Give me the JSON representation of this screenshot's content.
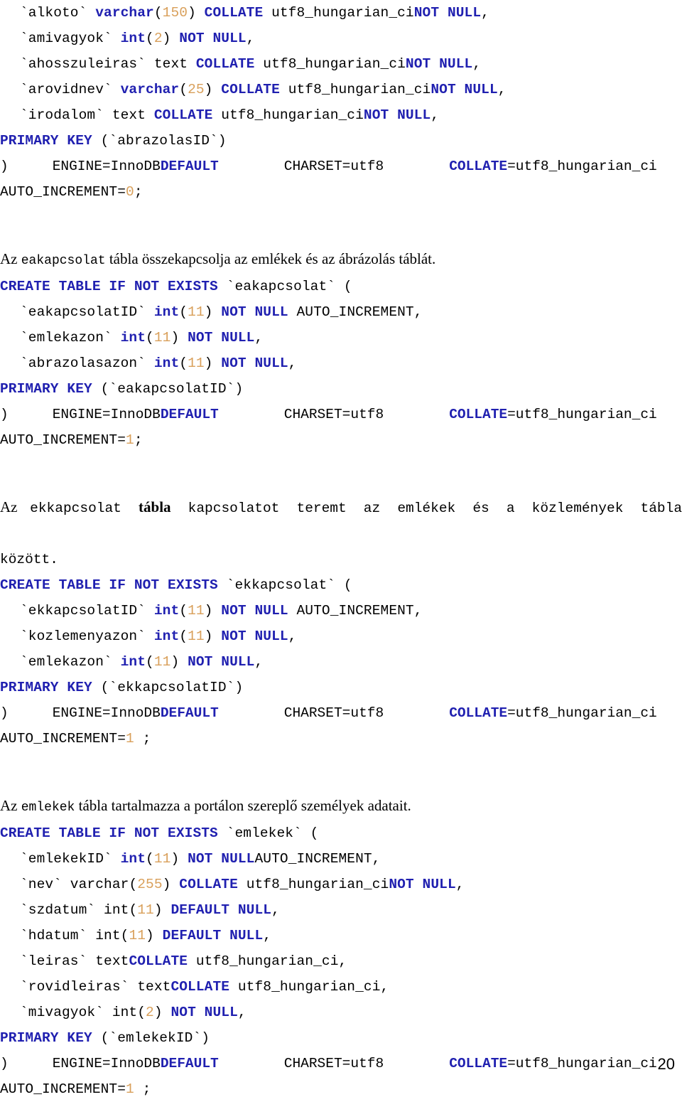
{
  "document": {
    "page_number": "20",
    "colors": {
      "keyword": "#2020B0",
      "number": "#D9A05B",
      "text": "#000000",
      "background": "#FFFFFF"
    }
  },
  "blocks": {
    "abrazolas_tail": {
      "lines": {
        "alkoto": {
          "name": "`alkoto` ",
          "type": "varchar",
          "open": "(",
          "size": "150",
          "close": ") ",
          "collate_kw": "COLLATE",
          "collate_val": " utf8_hungarian_ci",
          "nullness": "NOT NULL",
          "comma": ","
        },
        "amivagyok": {
          "name": "`amivagyok` ",
          "type": "int",
          "open": "(",
          "size": "2",
          "close": ") ",
          "nullness": "NOT NULL",
          "comma": ","
        },
        "ahosszuleiras": {
          "name": "`ahosszuleiras` ",
          "type": "text ",
          "collate_kw": "COLLATE",
          "collate_val": " utf8_hungarian_ci",
          "nullness": "NOT NULL",
          "comma": ","
        },
        "arovidnev": {
          "name": "`arovidnev` ",
          "type": "varchar",
          "open": "(",
          "size": "25",
          "close": ") ",
          "collate_kw": "COLLATE",
          "collate_val": " utf8_hungarian_ci",
          "nullness": "NOT NULL",
          "comma": ","
        },
        "irodalom": {
          "name": "`irodalom` ",
          "type": "text ",
          "collate_kw": "COLLATE",
          "collate_val": " utf8_hungarian_ci",
          "nullness": "NOT NULL",
          "comma": ","
        },
        "primary_key": {
          "kw": "PRIMARY KEY",
          "rest": " (`abrazolasID`)"
        },
        "engine": {
          "paren": ")",
          "engine": "ENGINE=InnoDB",
          "default_kw": "DEFAULT",
          "charset": "CHARSET=utf8",
          "collate_kw": "COLLATE",
          "collate_val": "=utf8_hungarian_ci"
        },
        "auto_increment": {
          "label": "AUTO_INCREMENT=",
          "value": "0",
          "semicolon": ";"
        }
      }
    },
    "eakapcsolat": {
      "prose": {
        "prefix": "Az ",
        "code": "eakapcsolat",
        "suffix": " tábla összekapcsolja az emlékek és az ábrázolás táblát."
      },
      "lines": {
        "create": {
          "kw": "CREATE TABLE IF NOT EXISTS",
          "rest": " `eakapcsolat` ("
        },
        "id": {
          "name": "`eakapcsolatID` ",
          "type": "int",
          "open": "(",
          "size": "11",
          "close": ") ",
          "nullness": "NOT NULL",
          "auto": " AUTO_INCREMENT,"
        },
        "emlekazon": {
          "name": "`emlekazon` ",
          "type": "int",
          "open": "(",
          "size": "11",
          "close": ") ",
          "nullness": "NOT NULL",
          "comma": ","
        },
        "abrazolasazon": {
          "name": "`abrazolasazon` ",
          "type": "int",
          "open": "(",
          "size": "11",
          "close": ") ",
          "nullness": "NOT NULL",
          "comma": ","
        },
        "primary_key": {
          "kw": "PRIMARY KEY",
          "rest": " (`eakapcsolatID`)"
        },
        "engine": {
          "paren": ")",
          "engine": "ENGINE=InnoDB",
          "default_kw": "DEFAULT",
          "charset": "CHARSET=utf8",
          "collate_kw": "COLLATE",
          "collate_val": "=utf8_hungarian_ci"
        },
        "auto_increment": {
          "label": "AUTO_INCREMENT=",
          "value": "1",
          "semicolon": ";"
        }
      }
    },
    "ekkapcsolat": {
      "prose": {
        "prefix": "Az ",
        "code": "ekkapcsolat",
        "bold": "tábla",
        "middle": "kapcsolatot teremt az emlékek és a közlemények tábla",
        "last": "között."
      },
      "lines": {
        "create": {
          "kw": "CREATE TABLE IF NOT EXISTS",
          "rest": " `ekkapcsolat` ("
        },
        "id": {
          "name": "`ekkapcsolatID` ",
          "type": "int",
          "open": "(",
          "size": "11",
          "close": ") ",
          "nullness": "NOT NULL",
          "auto": " AUTO_INCREMENT,"
        },
        "kozlemenyazon": {
          "name": "`kozlemenyazon` ",
          "type": "int",
          "open": "(",
          "size": "11",
          "close": ") ",
          "nullness": "NOT NULL",
          "comma": ","
        },
        "emlekazon": {
          "name": "`emlekazon` ",
          "type": "int",
          "open": "(",
          "size": "11",
          "close": ") ",
          "nullness": "NOT NULL",
          "comma": ","
        },
        "primary_key": {
          "kw": "PRIMARY KEY",
          "rest": " (`ekkapcsolatID`)"
        },
        "engine": {
          "paren": ")",
          "engine": "ENGINE=InnoDB",
          "default_kw": "DEFAULT",
          "charset": "CHARSET=utf8",
          "collate_kw": "COLLATE",
          "collate_val": "=utf8_hungarian_ci"
        },
        "auto_increment": {
          "label": "AUTO_INCREMENT=",
          "value": "1",
          "semicolon": " ;"
        }
      }
    },
    "emlekek": {
      "prose": {
        "prefix": "Az ",
        "code": "emlekek",
        "suffix": " tábla tartalmazza a portálon szereplő személyek adatait."
      },
      "lines": {
        "create": {
          "kw": "CREATE TABLE IF NOT EXISTS",
          "rest": " `emlekek` ("
        },
        "id": {
          "name": "`emlekekID` ",
          "type": "int",
          "open": "(",
          "size": "11",
          "close": ") ",
          "nullness": "NOT NULL",
          "auto": "AUTO_INCREMENT,"
        },
        "nev": {
          "name": "`nev` varchar",
          "open": "(",
          "size": "255",
          "close": ") ",
          "collate_kw": "COLLATE",
          "collate_val": " utf8_hungarian_ci",
          "nullness": "NOT NULL",
          "comma": ","
        },
        "szdatum": {
          "name": "`szdatum` int",
          "open": "(",
          "size": "11",
          "close": ") ",
          "nullness": "DEFAULT NULL",
          "comma": ","
        },
        "hdatum": {
          "name": "`hdatum` int",
          "open": "(",
          "size": "11",
          "close": ") ",
          "nullness": "DEFAULT NULL",
          "comma": ","
        },
        "leiras": {
          "name": "`leiras` text",
          "collate_kw": "COLLATE",
          "collate_val": " utf8_hungarian_ci,"
        },
        "rovidleiras": {
          "name": "`rovidleiras` text",
          "collate_kw": "COLLATE",
          "collate_val": " utf8_hungarian_ci,"
        },
        "mivagyok": {
          "name": "`mivagyok` int",
          "open": "(",
          "size": "2",
          "close": ") ",
          "nullness": "NOT NULL",
          "comma": ","
        },
        "primary_key": {
          "kw": "PRIMARY KEY",
          "rest": " (`emlekekID`)"
        },
        "engine": {
          "paren": ")",
          "engine": "ENGINE=InnoDB",
          "default_kw": "DEFAULT",
          "charset": "CHARSET=utf8",
          "collate_kw": "COLLATE",
          "collate_val": "=utf8_hungarian_ci"
        },
        "auto_increment": {
          "label": "AUTO_INCREMENT=",
          "value": "1",
          "semicolon": " ;"
        }
      }
    }
  }
}
